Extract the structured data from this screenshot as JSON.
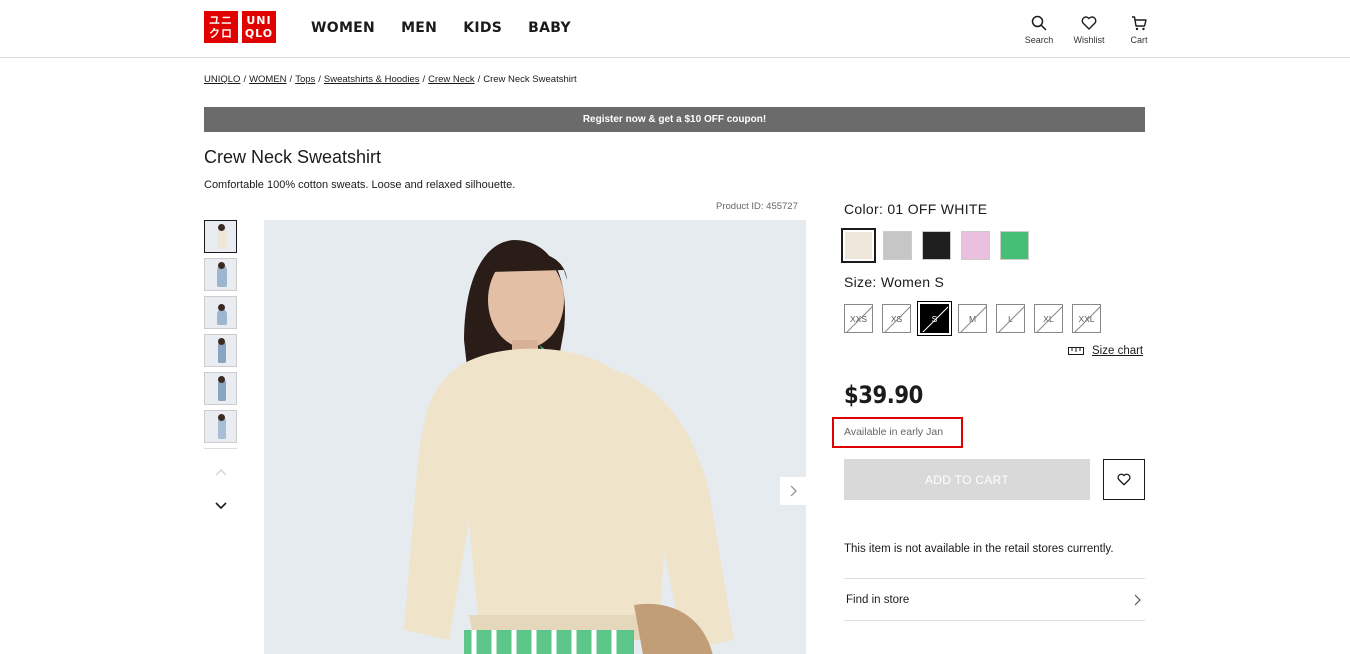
{
  "header": {
    "logo_top": "ユニ",
    "logo_bottom": "クロ",
    "logo_top_en": "UNI",
    "logo_bottom_en": "QLO",
    "nav": [
      "WOMEN",
      "MEN",
      "KIDS",
      "BABY"
    ],
    "icons": [
      {
        "icon": "search-icon",
        "label": "Search"
      },
      {
        "icon": "heart-icon",
        "label": "Wishlist"
      },
      {
        "icon": "cart-icon",
        "label": "Cart"
      }
    ]
  },
  "breadcrumb": {
    "links": [
      "UNIQLO",
      "WOMEN",
      "Tops",
      "Sweatshirts & Hoodies",
      "Crew Neck"
    ],
    "current": "Crew Neck Sweatshirt"
  },
  "banner": "Register now & get a $10 OFF coupon!",
  "product": {
    "title": "Crew Neck Sweatshirt",
    "description": "Comfortable 100% cotton sweats. Loose and relaxed silhouette.",
    "product_id": "Product ID: 455727",
    "color_label": "Color:  01 OFF WHITE",
    "colors": [
      "#efe6da",
      "#c6c6c6",
      "#1f1f1f",
      "#ebbfe0",
      "#44bf73"
    ],
    "size_label": "Size:  Women S",
    "sizes": [
      "XXS",
      "XS",
      "S",
      "M",
      "L",
      "XL",
      "XXL"
    ],
    "selected_size": "S",
    "size_chart": "Size chart",
    "price": "$39.90",
    "availability": "Available in early Jan",
    "add_to_cart": "ADD TO CART",
    "store_note": "This item is not available in the retail stores currently.",
    "find_in_store": "Find in store"
  },
  "colors": {
    "brand": "#e10000",
    "banner": "#6b6b6b",
    "disabled_button": "#d9d9d9",
    "highlight": "#e00000"
  }
}
